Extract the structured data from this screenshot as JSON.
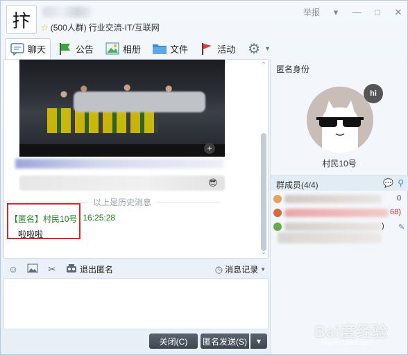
{
  "header": {
    "group_avatar_char": "抃",
    "member_count": "(500人群)",
    "category": "行业交流-IT/互联网",
    "report": "举报",
    "controls": [
      "▾",
      "—",
      "□",
      "✕"
    ]
  },
  "tabs": [
    {
      "label": "聊天",
      "icon": "chat-icon",
      "active": true
    },
    {
      "label": "公告",
      "icon": "flag-icon"
    },
    {
      "label": "相册",
      "icon": "photo-album-icon"
    },
    {
      "label": "文件",
      "icon": "folder-icon"
    },
    {
      "label": "活动",
      "icon": "red-flag-icon"
    }
  ],
  "chat": {
    "history_divider": "以上是历史消息",
    "message": {
      "sender_tag": "【匿名】",
      "sender_name": "村民10号",
      "time": "16:25:28",
      "text": "啦啦啦"
    }
  },
  "input_toolbar": {
    "exit_anonymous": "退出匿名",
    "history": "消息记录"
  },
  "buttons": {
    "close": "关闭(C)",
    "send": "匿名发送(S)",
    "arrow": "▾"
  },
  "right_panel": {
    "anon_title": "匿名身份",
    "hi_label": "hi",
    "anon_name": "村民10号",
    "members_title": "群成员(4/4)",
    "member_suffixes": [
      "0",
      "68)",
      ")"
    ]
  },
  "watermark": {
    "main": "Bai度经验",
    "sub": "jingyan.baidu.com"
  },
  "colors": {
    "accent_green": "#1a8c1a",
    "highlight_red": "#d9262a",
    "link_blue": "#3a8ad6"
  }
}
